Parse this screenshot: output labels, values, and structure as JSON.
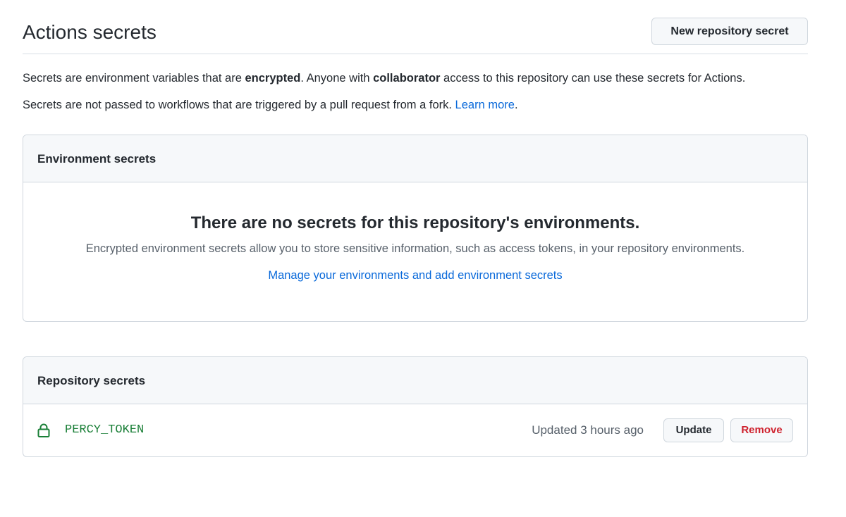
{
  "header": {
    "title": "Actions secrets",
    "new_secret_label": "New repository secret"
  },
  "description": {
    "line1_a": "Secrets are environment variables that are ",
    "line1_bold1": "encrypted",
    "line1_b": ". Anyone with ",
    "line1_bold2": "collaborator",
    "line1_c": " access to this repository can use these secrets for Actions.",
    "line2_text": "Secrets are not passed to workflows that are triggered by a pull request from a fork. ",
    "line2_link": "Learn more",
    "line2_end": "."
  },
  "environment_secrets": {
    "heading": "Environment secrets",
    "empty_title": "There are no secrets for this repository's environments.",
    "empty_text": "Encrypted environment secrets allow you to store sensitive information, such as access tokens, in your repository environments.",
    "manage_link": "Manage your environments and add environment secrets"
  },
  "repository_secrets": {
    "heading": "Repository secrets",
    "items": [
      {
        "icon": "lock-icon",
        "name": "PERCY_TOKEN",
        "updated": "Updated 3 hours ago",
        "update_label": "Update",
        "remove_label": "Remove"
      }
    ]
  },
  "colors": {
    "link": "#0969da",
    "secret_name": "#1a7f37",
    "danger": "#cf222e",
    "muted_text": "#57606a",
    "box_header_bg": "#f6f8fa",
    "border": "#d0d7de"
  }
}
